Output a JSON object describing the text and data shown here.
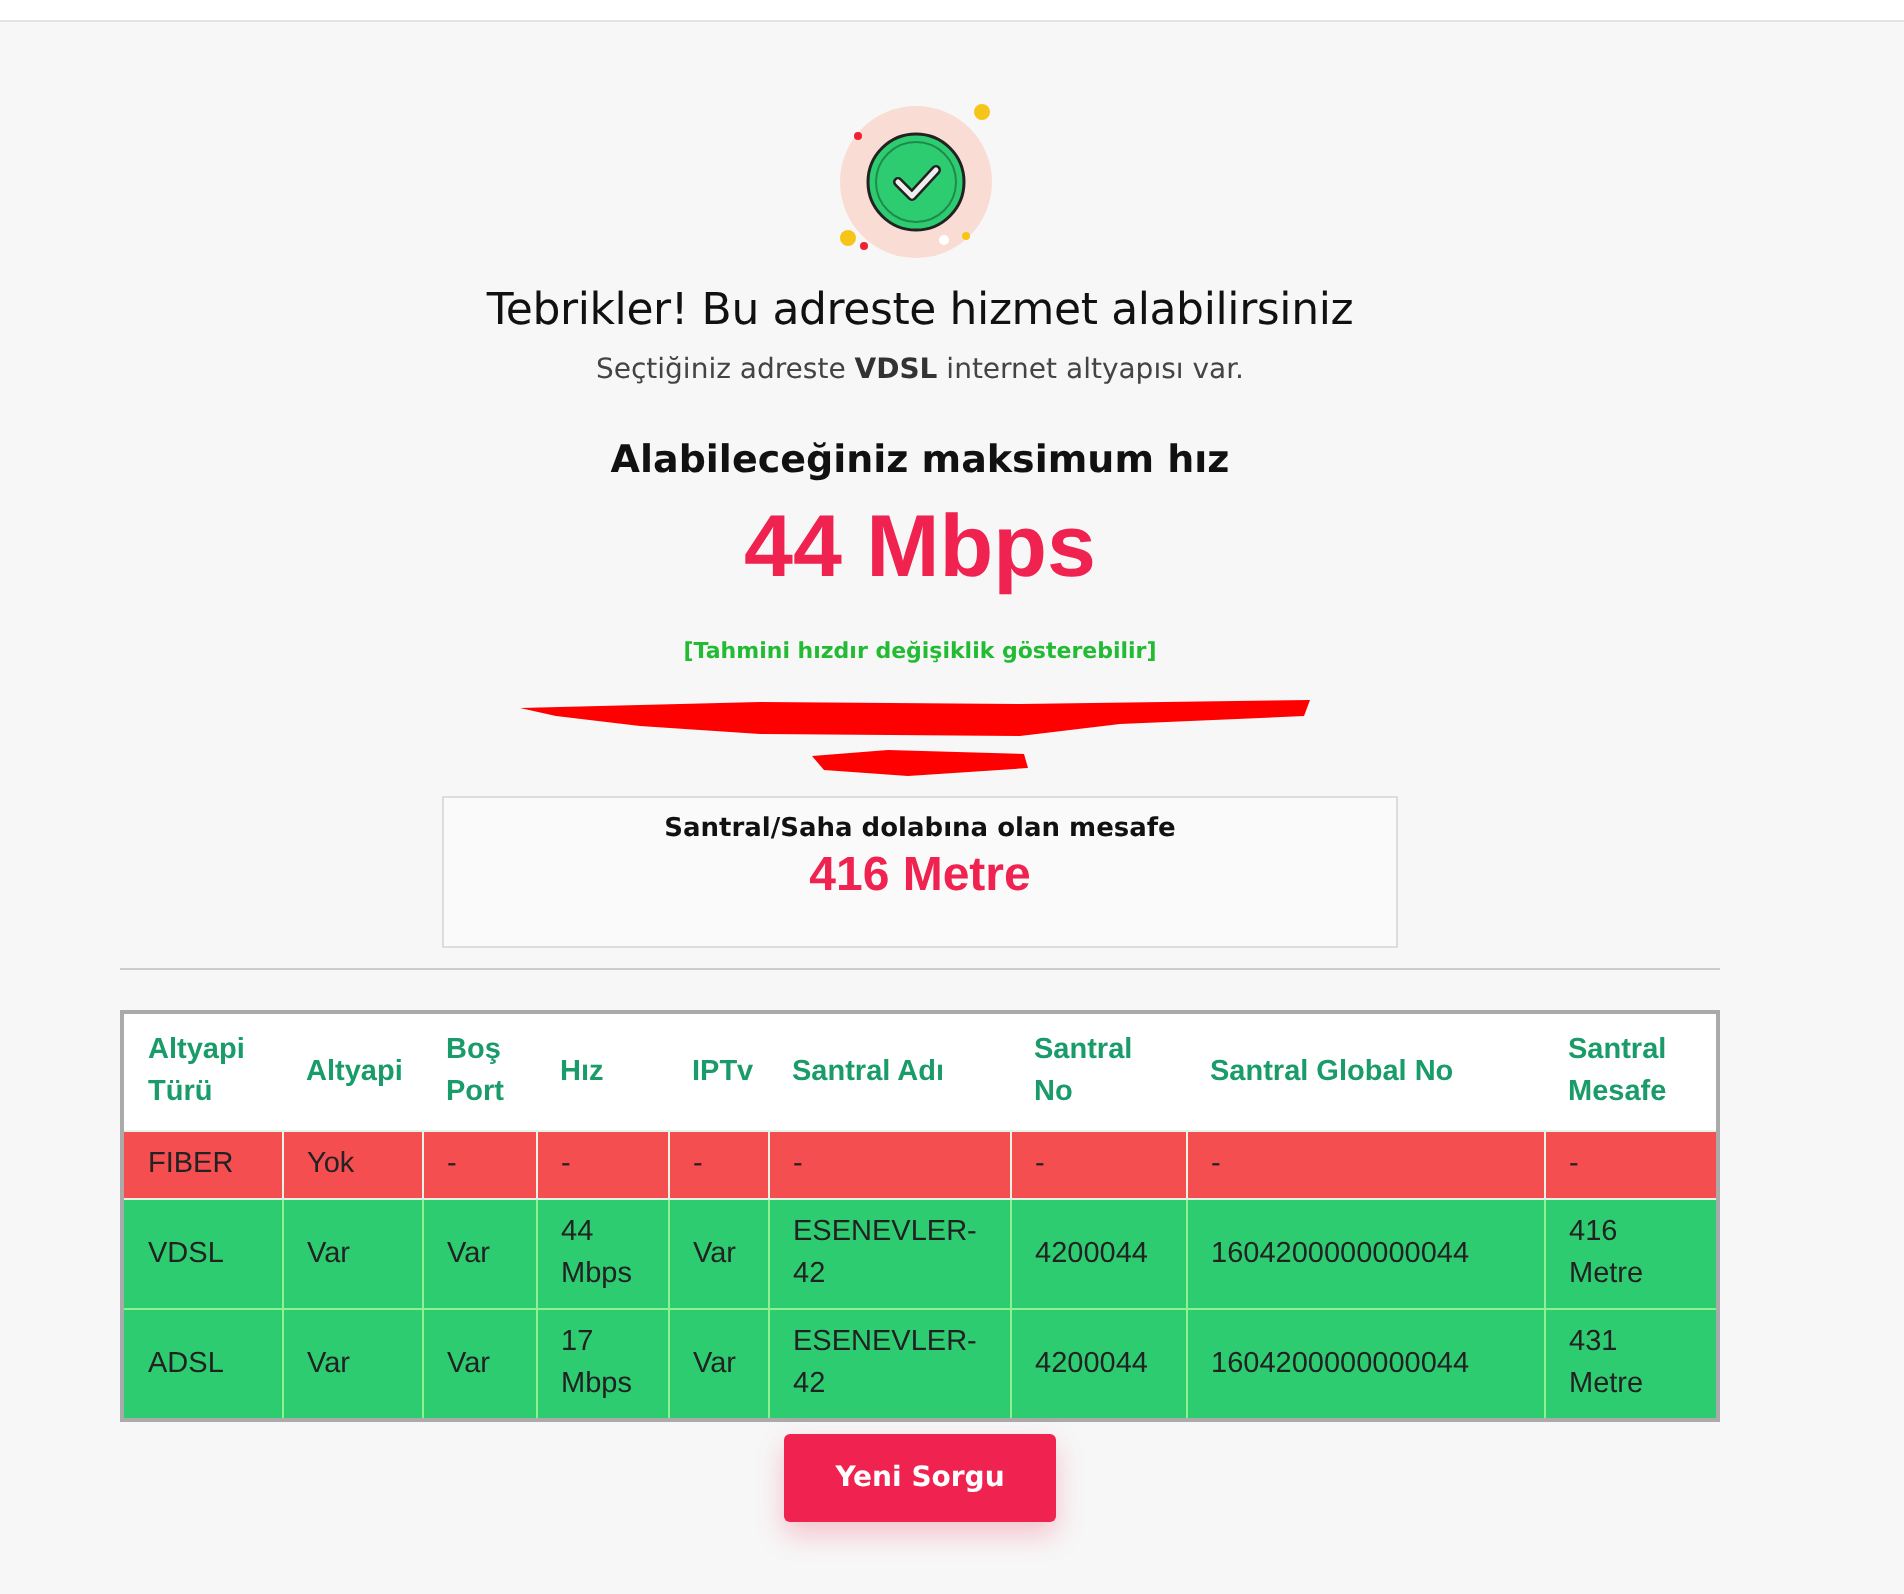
{
  "heading": "Tebrikler! Bu adreste hizmet alabilirsiniz",
  "subtitle": "Seçtiğiniz adreste **VDSL** internet altyapısı var.",
  "speed": {
    "label": "Alabileceğiniz maksimum hız",
    "value": "44 Mbps",
    "note": "[Tahmini hızdır değişiklik gösterebilir]"
  },
  "distance": {
    "label": "Santral/Saha dolabına olan mesafe",
    "value": "416 Metre"
  },
  "table": {
    "columns": [
      "Altyapi Türü",
      "Altyapi",
      "Boş Port",
      "Hız",
      "IPTv",
      "Santral Adı",
      "Santral No",
      "Santral Global No",
      "Santral Mesafe"
    ],
    "rows": [
      {
        "available": false,
        "cells": [
          "FIBER",
          "Yok",
          "-",
          "-",
          "-",
          "-",
          "-",
          "-",
          "-"
        ]
      },
      {
        "available": true,
        "cells": [
          "VDSL",
          "Var",
          "Var",
          "44 Mbps",
          "Var",
          "ESENEVLER-42",
          "4200044",
          "1604200000000044",
          "416 Metre"
        ]
      },
      {
        "available": true,
        "cells": [
          "ADSL",
          "Var",
          "Var",
          "17 Mbps",
          "Var",
          "ESENEVLER-42",
          "4200044",
          "1604200000000044",
          "431 Metre"
        ]
      }
    ]
  },
  "button": "Yeni Sorgu"
}
